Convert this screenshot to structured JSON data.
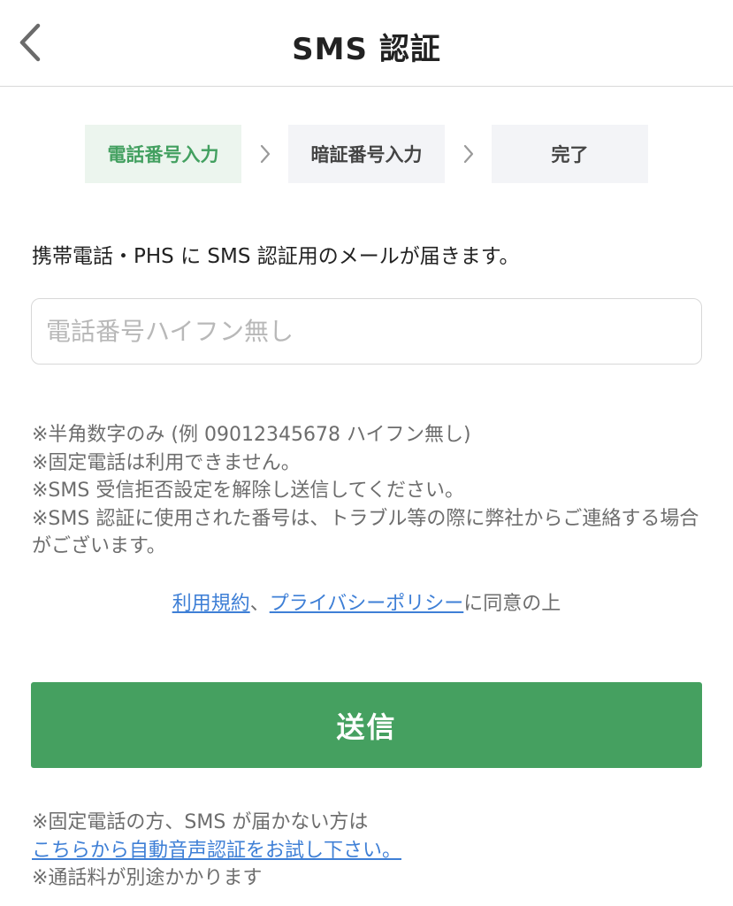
{
  "header": {
    "title": "SMS 認証",
    "back_icon": "chevron-left-icon"
  },
  "steps": [
    {
      "label": "電話番号入力",
      "active": true
    },
    {
      "label": "暗証番号入力",
      "active": false
    },
    {
      "label": "完了",
      "active": false
    }
  ],
  "intro": "携帯電話・PHS に SMS 認証用のメールが届きます。",
  "phone_input": {
    "value": "",
    "placeholder": "電話番号ハイフン無し"
  },
  "notes": [
    "※半角数字のみ (例 09012345678 ハイフン無し)",
    "※固定電話は利用できません。",
    "※SMS 受信拒否設定を解除し送信してください。",
    "※SMS 認証に使用された番号は、トラブル等の際に弊社からご連絡する場合がございます。"
  ],
  "agreement": {
    "terms_link": "利用規約",
    "separator": "、",
    "privacy_link": "プライバシーポリシー",
    "suffix": "に同意の上"
  },
  "submit_label": "送信",
  "footer": {
    "line1": "※固定電話の方、SMS が届かない方は",
    "voice_link": "こちらから自動音声認証をお試し下さい。",
    "line3": "※通話料が別途かかります"
  },
  "colors": {
    "accent": "#45a060",
    "link": "#3e7fd6",
    "step_active_bg": "#ecf5ee",
    "step_bg": "#f3f4f7"
  }
}
